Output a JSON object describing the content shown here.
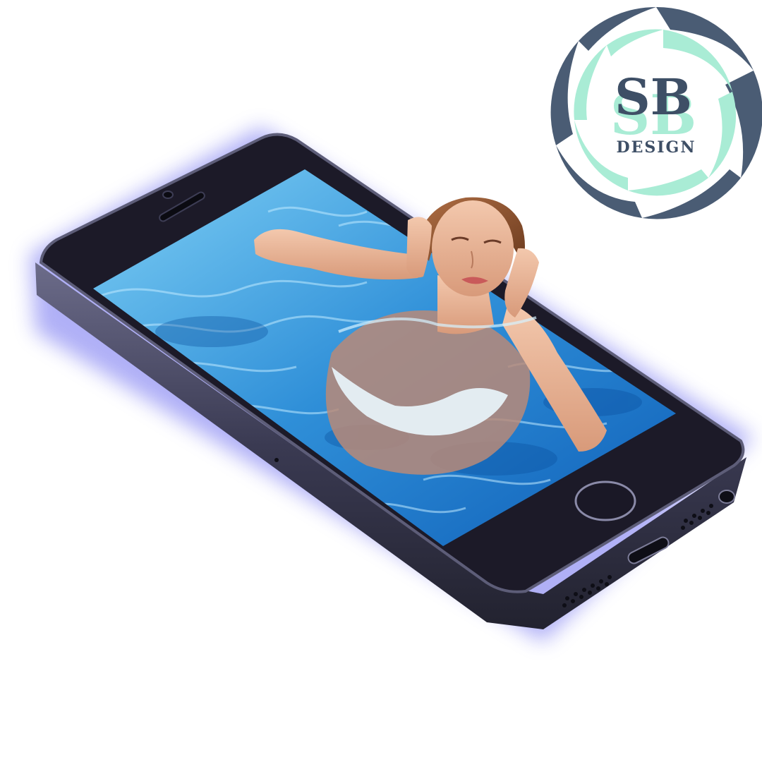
{
  "logo": {
    "monogram": "SB",
    "word": "DESIGN",
    "colors": {
      "ring_dark": "#4a5c74",
      "ring_light": "#a9ecd5",
      "text_dark": "#3e4f66",
      "text_light": "#a9ecd5"
    }
  },
  "phone": {
    "glow_color": "#6f6ff0",
    "body_color": "#2a2a3a",
    "bezel_color": "#1c1a28",
    "edge_color": "#5d5d78"
  },
  "screen": {
    "water_colors": [
      "#7fd0f5",
      "#2f8fd8",
      "#0f5fb8"
    ],
    "subject": "woman-swimming-in-pool"
  }
}
